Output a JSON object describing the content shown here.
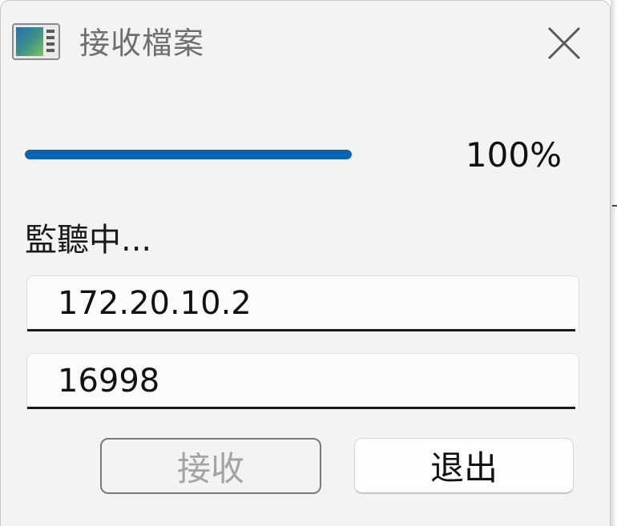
{
  "window": {
    "title": "接收檔案",
    "icon": "app-window-icon",
    "close_icon": "close-icon"
  },
  "progress": {
    "value": 1.0,
    "label": "100%",
    "color": "#0a64b4"
  },
  "status_text": "監聽中...",
  "fields": {
    "ip": {
      "value": "172.20.10.2"
    },
    "port": {
      "value": "16998"
    }
  },
  "buttons": {
    "receive": {
      "label": "接收",
      "enabled": false
    },
    "exit": {
      "label": "退出",
      "enabled": true
    }
  }
}
